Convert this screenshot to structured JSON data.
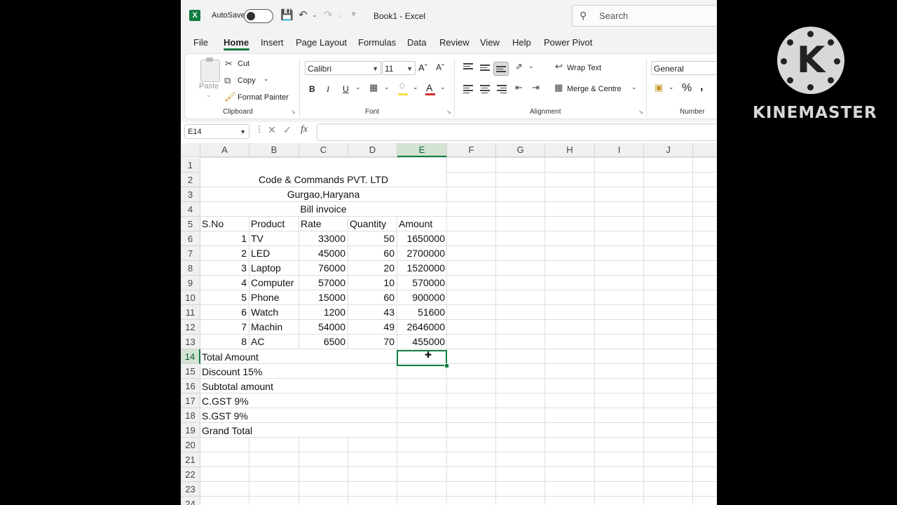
{
  "titlebar": {
    "autosave_label": "AutoSave",
    "doc_title": "Book1  -  Excel",
    "search_placeholder": "Search"
  },
  "tabs": [
    "File",
    "Home",
    "Insert",
    "Page Layout",
    "Formulas",
    "Data",
    "Review",
    "View",
    "Help",
    "Power Pivot"
  ],
  "ribbon": {
    "clipboard": {
      "paste": "Paste",
      "cut": "Cut",
      "copy": "Copy",
      "format_painter": "Format Painter",
      "label": "Clipboard"
    },
    "font": {
      "name": "Calibri",
      "size": "11",
      "bold": "B",
      "italic": "I",
      "underline": "U",
      "label": "Font"
    },
    "alignment": {
      "wrap_text": "Wrap Text",
      "merge": "Merge & Centre",
      "label": "Alignment"
    },
    "number": {
      "format": "General",
      "label": "Number"
    }
  },
  "formula_bar": {
    "name_box": "E14",
    "formula": ""
  },
  "columns": [
    "A",
    "B",
    "C",
    "D",
    "E",
    "F",
    "G",
    "H",
    "I",
    "J"
  ],
  "rows": [
    "1",
    "2",
    "3",
    "4",
    "5",
    "6",
    "7",
    "8",
    "9",
    "10",
    "11",
    "12",
    "13",
    "14",
    "15",
    "16",
    "17",
    "18",
    "19",
    "20",
    "21",
    "22",
    "23",
    "24"
  ],
  "sheet": {
    "title1": "Code & Commands PVT. LTD",
    "title2": "Gurgao,Haryana",
    "title3": "Bill invoice",
    "headers": [
      "S.No",
      "Product",
      "Rate",
      "Quantity",
      "Amount"
    ],
    "items": [
      {
        "sno": "1",
        "product": "TV",
        "rate": "33000",
        "qty": "50",
        "amount": "1650000"
      },
      {
        "sno": "2",
        "product": "LED",
        "rate": "45000",
        "qty": "60",
        "amount": "2700000"
      },
      {
        "sno": "3",
        "product": "Laptop",
        "rate": "76000",
        "qty": "20",
        "amount": "1520000"
      },
      {
        "sno": "4",
        "product": "Computer",
        "rate": "57000",
        "qty": "10",
        "amount": "570000"
      },
      {
        "sno": "5",
        "product": "Phone",
        "rate": "15000",
        "qty": "60",
        "amount": "900000"
      },
      {
        "sno": "6",
        "product": "Watch",
        "rate": "1200",
        "qty": "43",
        "amount": "51600"
      },
      {
        "sno": "7",
        "product": "Machin",
        "rate": "54000",
        "qty": "49",
        "amount": "2646000"
      },
      {
        "sno": "8",
        "product": "AC",
        "rate": "6500",
        "qty": "70",
        "amount": "455000"
      }
    ],
    "summary": [
      "Total Amount",
      "Discount 15%",
      "Subtotal amount",
      "C.GST 9%",
      "S.GST 9%",
      "Grand Total"
    ]
  },
  "watermark": {
    "brand": "KINEMASTER",
    "logo_letter": "K"
  },
  "colors": {
    "accent": "#107c41",
    "background": "#000000"
  }
}
